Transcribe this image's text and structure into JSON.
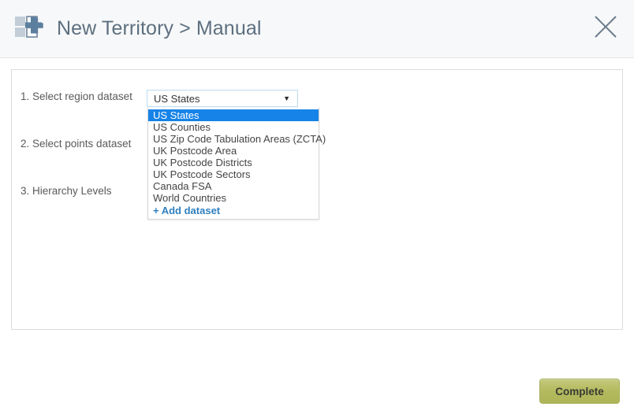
{
  "header": {
    "icon": "new-territory-grid-plus-icon",
    "title": "New Territory > Manual",
    "close_icon": "close-icon"
  },
  "panel": {
    "steps": [
      {
        "label": "1. Select region dataset"
      },
      {
        "label": "2. Select points dataset"
      },
      {
        "label": "3. Hierarchy Levels"
      }
    ],
    "region_select": {
      "value": "US States",
      "arrow_icon": "chevron-down-icon",
      "expanded": true,
      "options": [
        {
          "label": "US States",
          "selected": true,
          "action": false
        },
        {
          "label": "US Counties",
          "selected": false,
          "action": false
        },
        {
          "label": "US Zip Code Tabulation Areas (ZCTA)",
          "selected": false,
          "action": false
        },
        {
          "label": "UK Postcode Area",
          "selected": false,
          "action": false
        },
        {
          "label": "UK Postcode Districts",
          "selected": false,
          "action": false
        },
        {
          "label": "UK Postcode Sectors",
          "selected": false,
          "action": false
        },
        {
          "label": "Canada FSA",
          "selected": false,
          "action": false
        },
        {
          "label": "World Countries",
          "selected": false,
          "action": false
        },
        {
          "label": "+ Add dataset",
          "selected": false,
          "action": true
        }
      ]
    }
  },
  "footer": {
    "complete_label": "Complete"
  },
  "colors": {
    "header_bg": "#f7f8f9",
    "title_text": "#5d6f80",
    "highlight_blue": "#1683e8",
    "action_link": "#2e7fbf",
    "button_olive": "#b3ba5e",
    "select_border": "#b9dcf2"
  }
}
